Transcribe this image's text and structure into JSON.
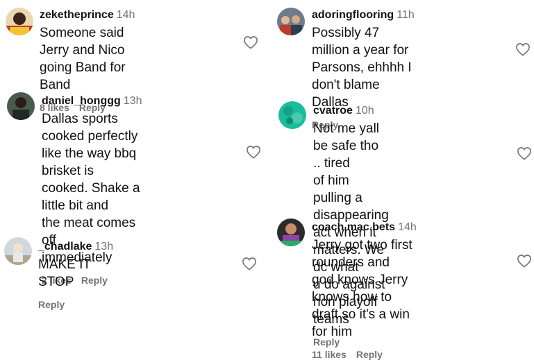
{
  "reply_label": "Reply",
  "comments": [
    {
      "user": "zeketheprince",
      "time": "14h",
      "text": "Someone said Jerry and Nico\ngoing Band for Band",
      "likes": "8 likes"
    },
    {
      "user": "daniel_honggg",
      "time": "13h",
      "text": "Dallas sports cooked perfectly\nlike the way bbq brisket is\ncooked. Shake a little bit and\nthe meat comes off\nimmediately",
      "likes": "2 likes"
    },
    {
      "user": "_chadlake",
      "time": "13h",
      "text": "MAKE IT STOP",
      "likes": ""
    },
    {
      "user": "adoringflooring",
      "time": "11h",
      "text": "Possibly 47 million a year for\nParsons, ehhhh I don't blame\nDallas",
      "likes": ""
    },
    {
      "user": "cvatroe",
      "time": "10h",
      "text": "Not me yall be safe tho .. tired\nof him pulling a disappearing\nact when it matters. We dc what\nu do against non playoff teams",
      "likes": ""
    },
    {
      "user": "coach.mac.bets",
      "time": "14h",
      "text": "Jerry got two first rounders and\ngod knows Jerry knows how to\ndraft so it's a win for him",
      "likes": "11 likes"
    }
  ],
  "icons": {
    "heart": "heart-outline-icon"
  },
  "colors": {
    "meta_gray": "#737373"
  }
}
